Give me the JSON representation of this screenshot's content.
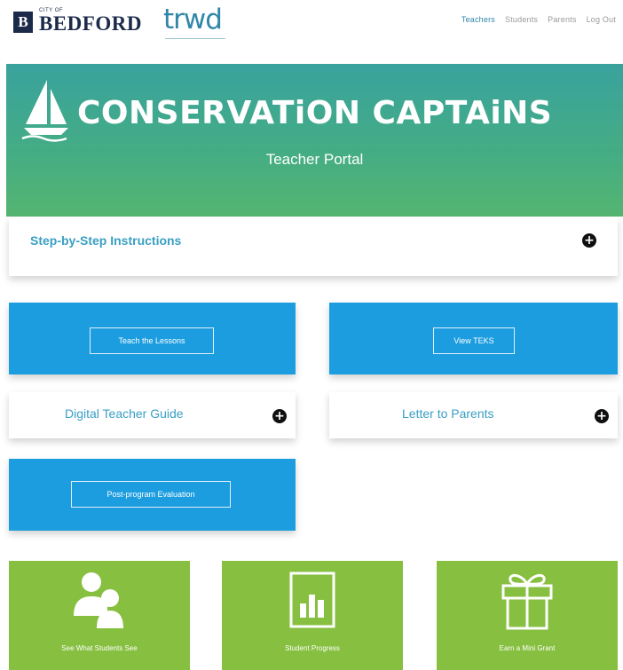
{
  "header": {
    "logo_letter": "B",
    "city_of": "CITY OF",
    "city_name": "BEDFORD",
    "partner": "trwd",
    "nav": [
      {
        "label": "Teachers",
        "active": true
      },
      {
        "label": "Students",
        "active": false
      },
      {
        "label": "Parents",
        "active": false
      },
      {
        "label": "Log Out",
        "active": false
      }
    ]
  },
  "hero": {
    "title": "CONSERVATiON CAPTAiNS",
    "subtitle": "Teacher Portal"
  },
  "instructions": {
    "label": "Step-by-Step Instructions"
  },
  "cards": {
    "teach_lessons": "Teach the Lessons",
    "view_teks": "View TEKS",
    "teacher_guide": "Digital Teacher Guide",
    "letter_parents": "Letter to Parents",
    "evaluation": "Post-program Evaluation"
  },
  "tiles": [
    {
      "label": "See What Students See",
      "icon": "users-icon"
    },
    {
      "label": "Student Progress",
      "icon": "bar-chart-icon"
    },
    {
      "label": "Earn a Mini Grant",
      "icon": "gift-icon"
    }
  ],
  "colors": {
    "blue": "#1b9de0",
    "green": "#87bf40",
    "link": "#3a9fc3",
    "navy": "#1c2a4a"
  }
}
